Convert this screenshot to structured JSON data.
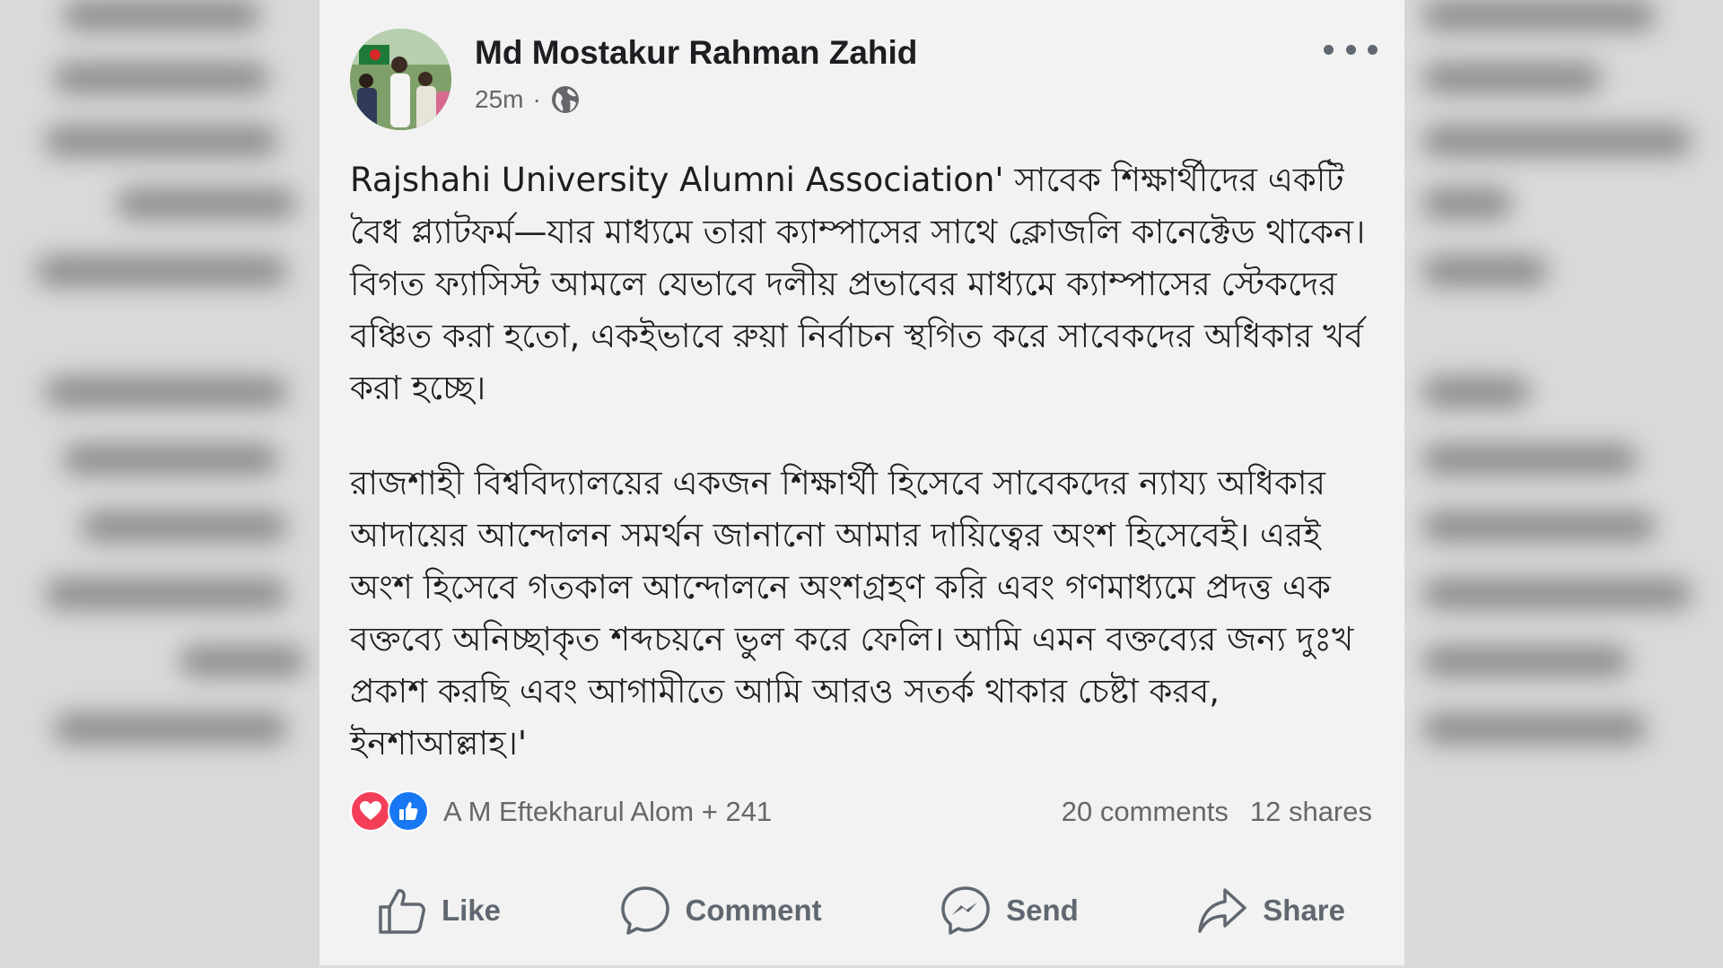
{
  "post": {
    "author": "Md Mostakur Rahman Zahid",
    "time": "25m",
    "separator": "·",
    "privacy_icon": "globe-icon",
    "paragraphs": [
      "Rajshahi University Alumni Association' সাবেক শিক্ষার্থীদের একটি বৈধ প্ল্যাটফর্ম—যার মাধ্যমে তারা ক্যাম্পাসের সাথে ক্লোজলি কানেক্টেড থাকেন। বিগত ফ্যাসিস্ট আমলে যেভাবে দলীয় প্রভাবের মাধ্যমে ক্যাম্পাসের স্টেকদের বঞ্চিত করা হতো, একইভাবে রুয়া নির্বাচন স্থগিত করে সাবেকদের অধিকার খর্ব করা হচ্ছে।",
      "রাজশাহী বিশ্ববিদ্যালয়ের একজন শিক্ষার্থী হিসেবে সাবেকদের ন্যায্য অধিকার আদায়ের আন্দোলন সমর্থন জানানো আমার দায়িত্বের অংশ হিসেবেই। এরই অংশ হিসেবে গতকাল আন্দোলনে অংশগ্রহণ করি এবং গণমাধ্যমে প্রদত্ত এক বক্তব্যে অনিচ্ছাকৃত শব্দচয়নে ভুল করে ফেলি। আমি এমন বক্তব্যের জন্য দুঃখ প্রকাশ করছি এবং আগামীতে আমি আরও সতর্ক থাকার চেষ্টা করব, ইনশাআল্লাহ।'"
    ]
  },
  "reactions": {
    "icons": [
      "heart-icon",
      "like-icon"
    ],
    "summary": "A M Eftekharul Alom + 241",
    "comments": "20 comments",
    "shares": "12 shares"
  },
  "actions": {
    "like": "Like",
    "comment": "Comment",
    "send": "Send",
    "share": "Share"
  },
  "colors": {
    "card_bg": "#f2f2f2",
    "text": "#1c1e21",
    "secondary": "#65676b",
    "like_blue": "#1877f2",
    "heart_red": "#f33e58"
  }
}
